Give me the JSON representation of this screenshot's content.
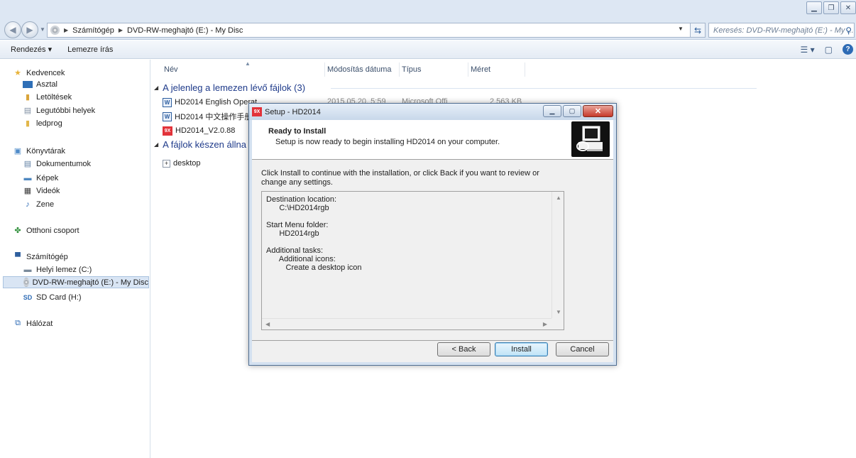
{
  "window": {
    "caption_buttons": [
      "minimize",
      "restore",
      "close"
    ]
  },
  "address": {
    "crumbs": [
      "Számítógép",
      "DVD-RW-meghajtó (E:) - My Disc"
    ],
    "search_placeholder": "Keresés: DVD-RW-meghajtó (E:) - My ..."
  },
  "toolbar": {
    "organize": "Rendezés ▾",
    "burn": "Lemezre írás"
  },
  "sidebar": {
    "favorites": "Kedvencek",
    "fav_items": [
      "Asztal",
      "Letöltések",
      "Legutóbbi helyek",
      "ledprog"
    ],
    "libraries": "Könyvtárak",
    "lib_items": [
      "Dokumentumok",
      "Képek",
      "Videók",
      "Zene"
    ],
    "homegroup": "Otthoni csoport",
    "computer": "Számítógép",
    "comp_items": [
      "Helyi lemez (C:)",
      "DVD-RW-meghajtó (E:) - My Disc",
      "SD Card (H:)"
    ],
    "network": "Hálózat"
  },
  "columns": {
    "name": "Név",
    "modified": "Módosítás dátuma",
    "type": "Típus",
    "size": "Méret"
  },
  "groups": {
    "on_disc": "A jelenleg a lemezen lévő fájlok (3)",
    "ready": "A fájlok készen állna"
  },
  "files": [
    {
      "name": "HD2014 English Operat",
      "date": "2015.05.20. 5:59",
      "type": "Microsoft Offi",
      "size": "2 563 KB"
    },
    {
      "name": "HD2014 中文操作手册",
      "date": "",
      "type": "",
      "size": ""
    },
    {
      "name": "HD2014_V2.0.88",
      "date": "",
      "type": "",
      "size": ""
    }
  ],
  "pending": [
    "desktop"
  ],
  "dialog": {
    "title": "Setup - HD2014",
    "header_title": "Ready to Install",
    "header_sub": "Setup is now ready to begin installing HD2014 on your computer.",
    "intro": "Click Install to continue with the installation, or click Back if you want to review or change any settings.",
    "summary": "Destination location:\n      C:\\HD2014rgb\n\nStart Menu folder:\n      HD2014rgb\n\nAdditional tasks:\n      Additional icons:\n         Create a desktop icon",
    "back": "< Back",
    "install": "Install",
    "cancel": "Cancel"
  },
  "colors": {
    "accent": "#2d6bb5",
    "close_red": "#c6392a",
    "app_icon": "#e2333a"
  }
}
